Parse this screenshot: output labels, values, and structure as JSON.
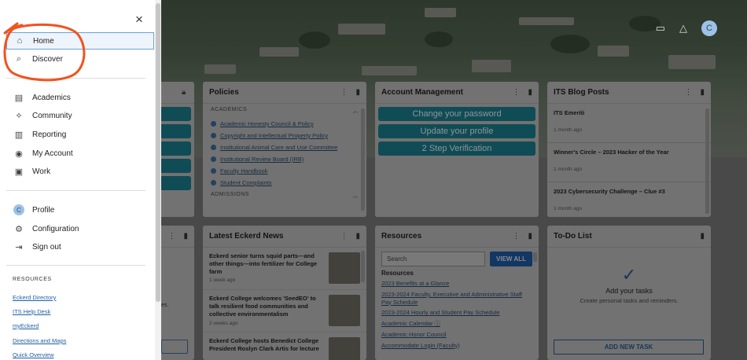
{
  "header": {
    "avatar_initial": "C"
  },
  "drawer": {
    "close_label": "×",
    "primary": [
      {
        "label": "Home",
        "icon": "home-icon"
      },
      {
        "label": "Discover",
        "icon": "search-icon"
      }
    ],
    "sections": [
      {
        "label": "Academics",
        "icon": "book-icon"
      },
      {
        "label": "Community",
        "icon": "community-icon"
      },
      {
        "label": "Reporting",
        "icon": "chart-icon"
      },
      {
        "label": "My Account",
        "icon": "account-icon"
      },
      {
        "label": "Work",
        "icon": "briefcase-icon"
      }
    ],
    "profile": {
      "initial": "C",
      "label": "Profile"
    },
    "configuration": "Configuration",
    "sign_out": "Sign out",
    "resources_heading": "RESOURCES",
    "resource_links": [
      "Eckerd Directory",
      "ITS Help Desk",
      "myEckerd",
      "Directions and Maps",
      "Quick Overview"
    ]
  },
  "policies": {
    "title": "Policies",
    "section1": "ACADEMICS",
    "items": [
      "Academic Honesty Council & Policy",
      "Copyright and Intellectual Property Policy",
      "Institutional Animal Care and Use Committee",
      "Institutional Review Board (IRB)",
      "Faculty Handbook",
      "Student Complaints"
    ],
    "section2": "ADMISSIONS"
  },
  "account": {
    "title": "Account Management",
    "buttons": [
      "Change your password",
      "Update your profile",
      "2 Step Verification"
    ]
  },
  "blog": {
    "title": "ITS Blog Posts",
    "posts": [
      {
        "title": "ITS Emeriti",
        "date": "1 month ago"
      },
      {
        "title": "Winner's Circle – 2023 Hacker of the Year",
        "date": "1 month ago"
      },
      {
        "title": "2023 Cybersecurity Challenge – Clue #3",
        "date": "1 month ago"
      }
    ]
  },
  "news": {
    "title": "Latest Eckerd News",
    "items": [
      {
        "title": "Eckerd senior turns squid parts—and other things—into fertilizer for College farm",
        "date": "1 week ago"
      },
      {
        "title": "Eckerd College welcomes 'SeedEO' to talk resilient food communities and collective environmentalism",
        "date": "2 weeks ago"
      },
      {
        "title": "Eckerd College hosts Benedict College President Roslyn Clark Artis for lecture",
        "date": ""
      }
    ]
  },
  "resources": {
    "title": "Resources",
    "search_placeholder": "Search",
    "view_all": "VIEW ALL",
    "heading": "Resources",
    "links": [
      "2023 Benefits at a Glance",
      "2023-2024 Faculty, Executive and Administrative Staff Pay Schedule",
      "2023-2024 Hourly and Student Pay Schedule",
      "Academic Calendar",
      "Academic Honor Council",
      "Accommodate Login (Faculty)"
    ]
  },
  "todo": {
    "title": "To-Do List",
    "empty_title": "Add your tasks",
    "empty_sub": "Create personal tasks and reminders.",
    "add_button": "ADD NEW TASK"
  },
  "partial": {
    "text": "es."
  }
}
